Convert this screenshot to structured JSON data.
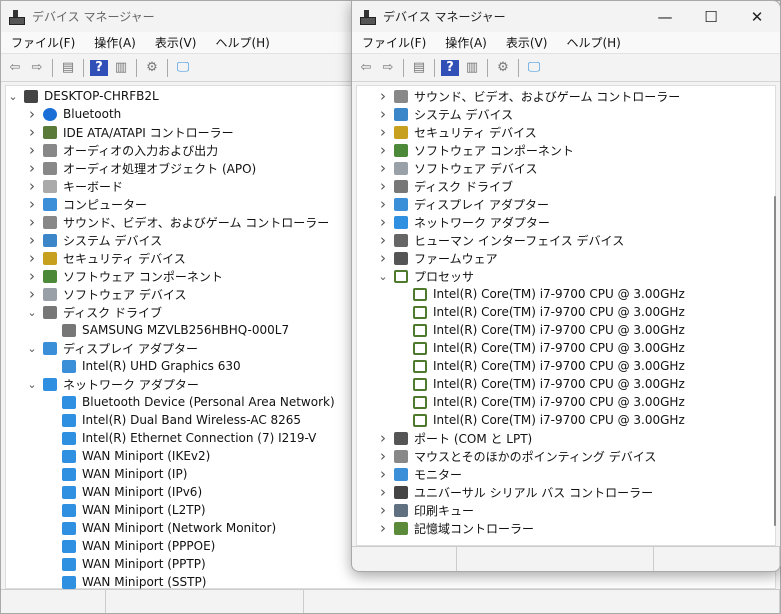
{
  "window": {
    "title": "デバイス マネージャー",
    "minimize": "—",
    "maximize": "☐",
    "close": "✕"
  },
  "menu": [
    "ファイル(F)",
    "操作(A)",
    "表示(V)",
    "ヘルプ(H)"
  ],
  "toolbar_icons": [
    "back-arrow-icon",
    "forward-arrow-icon",
    "show-hide-console-tree-icon",
    "help-icon",
    "action-pane-icon",
    "update-driver-icon",
    "scan-hardware-icon"
  ],
  "left_tree": [
    {
      "l": 0,
      "e": "open",
      "t": "DESKTOP-CHRFB2L",
      "i": "computer"
    },
    {
      "l": 1,
      "e": "closed",
      "t": "Bluetooth",
      "i": "bluetooth"
    },
    {
      "l": 1,
      "e": "closed",
      "t": "IDE ATA/ATAPI コントローラー",
      "i": "ide"
    },
    {
      "l": 1,
      "e": "closed",
      "t": "オーディオの入力および出力",
      "i": "audio"
    },
    {
      "l": 1,
      "e": "closed",
      "t": "オーディオ処理オブジェクト (APO)",
      "i": "audio"
    },
    {
      "l": 1,
      "e": "closed",
      "t": "キーボード",
      "i": "keyboard"
    },
    {
      "l": 1,
      "e": "closed",
      "t": "コンピューター",
      "i": "monitor"
    },
    {
      "l": 1,
      "e": "closed",
      "t": "サウンド、ビデオ、およびゲーム コントローラー",
      "i": "audio"
    },
    {
      "l": 1,
      "e": "closed",
      "t": "システム デバイス",
      "i": "system"
    },
    {
      "l": 1,
      "e": "closed",
      "t": "セキュリティ デバイス",
      "i": "security"
    },
    {
      "l": 1,
      "e": "closed",
      "t": "ソフトウェア コンポーネント",
      "i": "component"
    },
    {
      "l": 1,
      "e": "closed",
      "t": "ソフトウェア デバイス",
      "i": "software"
    },
    {
      "l": 1,
      "e": "open",
      "t": "ディスク ドライブ",
      "i": "disk"
    },
    {
      "l": 2,
      "e": "",
      "t": "SAMSUNG MZVLB256HBHQ-000L7",
      "i": "disk"
    },
    {
      "l": 1,
      "e": "open",
      "t": "ディスプレイ アダプター",
      "i": "display"
    },
    {
      "l": 2,
      "e": "",
      "t": "Intel(R) UHD Graphics 630",
      "i": "display"
    },
    {
      "l": 1,
      "e": "open",
      "t": "ネットワーク アダプター",
      "i": "network"
    },
    {
      "l": 2,
      "e": "",
      "t": "Bluetooth Device (Personal Area Network)",
      "i": "network"
    },
    {
      "l": 2,
      "e": "",
      "t": "Intel(R) Dual Band Wireless-AC 8265",
      "i": "network"
    },
    {
      "l": 2,
      "e": "",
      "t": "Intel(R) Ethernet Connection (7) I219-V",
      "i": "network"
    },
    {
      "l": 2,
      "e": "",
      "t": "WAN Miniport (IKEv2)",
      "i": "network"
    },
    {
      "l": 2,
      "e": "",
      "t": "WAN Miniport (IP)",
      "i": "network"
    },
    {
      "l": 2,
      "e": "",
      "t": "WAN Miniport (IPv6)",
      "i": "network"
    },
    {
      "l": 2,
      "e": "",
      "t": "WAN Miniport (L2TP)",
      "i": "network"
    },
    {
      "l": 2,
      "e": "",
      "t": "WAN Miniport (Network Monitor)",
      "i": "network"
    },
    {
      "l": 2,
      "e": "",
      "t": "WAN Miniport (PPPOE)",
      "i": "network"
    },
    {
      "l": 2,
      "e": "",
      "t": "WAN Miniport (PPTP)",
      "i": "network"
    },
    {
      "l": 2,
      "e": "",
      "t": "WAN Miniport (SSTP)",
      "i": "network"
    }
  ],
  "right_tree": [
    {
      "l": 1,
      "e": "closed",
      "t": "サウンド、ビデオ、およびゲーム コントローラー",
      "i": "audio"
    },
    {
      "l": 1,
      "e": "closed",
      "t": "システム デバイス",
      "i": "system"
    },
    {
      "l": 1,
      "e": "closed",
      "t": "セキュリティ デバイス",
      "i": "security"
    },
    {
      "l": 1,
      "e": "closed",
      "t": "ソフトウェア コンポーネント",
      "i": "component"
    },
    {
      "l": 1,
      "e": "closed",
      "t": "ソフトウェア デバイス",
      "i": "software"
    },
    {
      "l": 1,
      "e": "closed",
      "t": "ディスク ドライブ",
      "i": "disk"
    },
    {
      "l": 1,
      "e": "closed",
      "t": "ディスプレイ アダプター",
      "i": "display"
    },
    {
      "l": 1,
      "e": "closed",
      "t": "ネットワーク アダプター",
      "i": "network"
    },
    {
      "l": 1,
      "e": "closed",
      "t": "ヒューマン インターフェイス デバイス",
      "i": "hid"
    },
    {
      "l": 1,
      "e": "closed",
      "t": "ファームウェア",
      "i": "firmware"
    },
    {
      "l": 1,
      "e": "open",
      "t": "プロセッサ",
      "i": "cpu"
    },
    {
      "l": 2,
      "e": "",
      "t": "Intel(R) Core(TM) i7-9700 CPU @ 3.00GHz",
      "i": "cpu"
    },
    {
      "l": 2,
      "e": "",
      "t": "Intel(R) Core(TM) i7-9700 CPU @ 3.00GHz",
      "i": "cpu"
    },
    {
      "l": 2,
      "e": "",
      "t": "Intel(R) Core(TM) i7-9700 CPU @ 3.00GHz",
      "i": "cpu"
    },
    {
      "l": 2,
      "e": "",
      "t": "Intel(R) Core(TM) i7-9700 CPU @ 3.00GHz",
      "i": "cpu"
    },
    {
      "l": 2,
      "e": "",
      "t": "Intel(R) Core(TM) i7-9700 CPU @ 3.00GHz",
      "i": "cpu"
    },
    {
      "l": 2,
      "e": "",
      "t": "Intel(R) Core(TM) i7-9700 CPU @ 3.00GHz",
      "i": "cpu"
    },
    {
      "l": 2,
      "e": "",
      "t": "Intel(R) Core(TM) i7-9700 CPU @ 3.00GHz",
      "i": "cpu"
    },
    {
      "l": 2,
      "e": "",
      "t": "Intel(R) Core(TM) i7-9700 CPU @ 3.00GHz",
      "i": "cpu"
    },
    {
      "l": 1,
      "e": "closed",
      "t": "ポート (COM と LPT)",
      "i": "port"
    },
    {
      "l": 1,
      "e": "closed",
      "t": "マウスとそのほかのポインティング デバイス",
      "i": "mouse"
    },
    {
      "l": 1,
      "e": "closed",
      "t": "モニター",
      "i": "monitor"
    },
    {
      "l": 1,
      "e": "closed",
      "t": "ユニバーサル シリアル バス コントローラー",
      "i": "usb"
    },
    {
      "l": 1,
      "e": "closed",
      "t": "印刷キュー",
      "i": "printer"
    },
    {
      "l": 1,
      "e": "closed",
      "t": "記憶域コントローラー",
      "i": "storage"
    }
  ],
  "icon_colors": {
    "computer": "#444444",
    "bluetooth": "#1a6fd6",
    "ide": "#5a7a3a",
    "audio": "#888888",
    "keyboard": "#aaaaaa",
    "monitor": "#3b8fd9",
    "system": "#3a86c8",
    "security": "#c8a020",
    "component": "#4c8a3a",
    "software": "#9aa0a8",
    "disk": "#777777",
    "display": "#3b8fd9",
    "network": "#2f8fe0",
    "hid": "#666666",
    "firmware": "#555555",
    "cpu": "#4e7a2e",
    "port": "#555555",
    "mouse": "#888888",
    "usb": "#444444",
    "printer": "#607080",
    "storage": "#5a8a3a"
  }
}
